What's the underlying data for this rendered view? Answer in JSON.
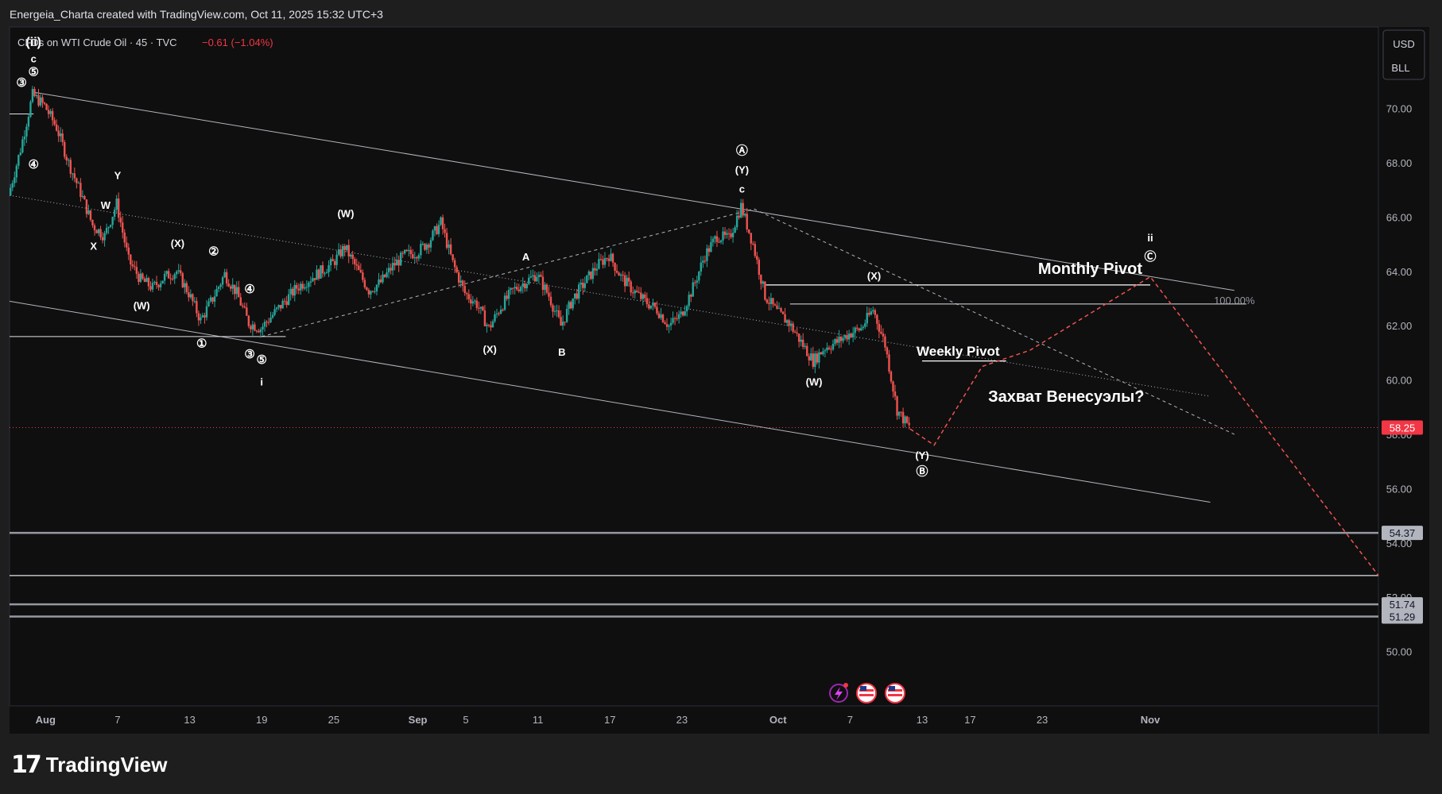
{
  "header": {
    "attribution": "Energeia_Charta created with TradingView.com, Oct 11, 2025 15:32 UTC+3"
  },
  "legend": {
    "symbol": "CFDs on WTI Crude Oil · 45 · TVC",
    "change": "−0.61 (−1.04%)"
  },
  "price_scale": {
    "currency": "USD",
    "unit": "BLL"
  },
  "footer": {
    "logo_word": "TradingView"
  },
  "colors": {
    "background": "#0f0f0f",
    "up": "#26a69a",
    "down": "#ef5350",
    "last_price": "#f23645",
    "grid_line": "#d1d4dc",
    "projection": "#ef5350"
  },
  "icons": [
    "lightning-event-icon",
    "us-flag-icon",
    "us-flag-icon"
  ],
  "chart_data": {
    "type": "candlestick",
    "title": "CFDs on WTI Crude Oil · 45 · TVC",
    "xlabel": "",
    "ylabel": "",
    "ylim": [
      48,
      73
    ],
    "xlim": [
      "2025-07-29",
      "2025-11-20"
    ],
    "y_ticks": [
      50,
      52,
      54,
      56,
      58,
      60,
      62,
      64,
      66,
      68,
      70,
      72
    ],
    "x_ticks": [
      {
        "date": "2025-08-01",
        "label": "Aug"
      },
      {
        "date": "2025-08-07",
        "label": "7"
      },
      {
        "date": "2025-08-13",
        "label": "13"
      },
      {
        "date": "2025-08-19",
        "label": "19"
      },
      {
        "date": "2025-08-25",
        "label": "25"
      },
      {
        "date": "2025-09-01",
        "label": "Sep"
      },
      {
        "date": "2025-09-05",
        "label": "5"
      },
      {
        "date": "2025-09-11",
        "label": "11"
      },
      {
        "date": "2025-09-17",
        "label": "17"
      },
      {
        "date": "2025-09-23",
        "label": "23"
      },
      {
        "date": "2025-10-01",
        "label": "Oct"
      },
      {
        "date": "2025-10-07",
        "label": "7"
      },
      {
        "date": "2025-10-13",
        "label": "13"
      },
      {
        "date": "2025-10-17",
        "label": "17"
      },
      {
        "date": "2025-10-23",
        "label": "23"
      },
      {
        "date": "2025-11-01",
        "label": "Nov"
      }
    ],
    "price_path": [
      [
        "2025-07-29",
        66.8
      ],
      [
        "2025-07-30",
        68.5
      ],
      [
        "2025-07-31",
        70.5
      ],
      [
        "2025-08-01",
        70.1
      ],
      [
        "2025-08-02",
        69.3
      ],
      [
        "2025-08-03",
        68.0
      ],
      [
        "2025-08-04",
        66.9
      ],
      [
        "2025-08-05",
        65.7
      ],
      [
        "2025-08-06",
        65.3
      ],
      [
        "2025-08-07",
        66.5
      ],
      [
        "2025-08-08",
        64.4
      ],
      [
        "2025-08-09",
        63.7
      ],
      [
        "2025-08-10",
        63.4
      ],
      [
        "2025-08-11",
        63.8
      ],
      [
        "2025-08-12",
        64.0
      ],
      [
        "2025-08-13",
        63.2
      ],
      [
        "2025-08-14",
        62.2
      ],
      [
        "2025-08-15",
        63.0
      ],
      [
        "2025-08-16",
        63.9
      ],
      [
        "2025-08-17",
        63.2
      ],
      [
        "2025-08-18",
        62.1
      ],
      [
        "2025-08-19",
        61.9
      ],
      [
        "2025-08-20",
        62.4
      ],
      [
        "2025-08-21",
        62.9
      ],
      [
        "2025-08-22",
        63.4
      ],
      [
        "2025-08-23",
        63.7
      ],
      [
        "2025-08-24",
        64.0
      ],
      [
        "2025-08-25",
        64.3
      ],
      [
        "2025-08-26",
        64.9
      ],
      [
        "2025-08-27",
        64.1
      ],
      [
        "2025-08-28",
        63.3
      ],
      [
        "2025-08-29",
        63.6
      ],
      [
        "2025-08-30",
        64.2
      ],
      [
        "2025-08-31",
        64.6
      ],
      [
        "2025-09-01",
        64.7
      ],
      [
        "2025-09-02",
        65.1
      ],
      [
        "2025-09-03",
        65.8
      ],
      [
        "2025-09-04",
        64.3
      ],
      [
        "2025-09-05",
        63.2
      ],
      [
        "2025-09-06",
        62.8
      ],
      [
        "2025-09-07",
        61.9
      ],
      [
        "2025-09-08",
        62.7
      ],
      [
        "2025-09-09",
        63.3
      ],
      [
        "2025-09-10",
        63.6
      ],
      [
        "2025-09-11",
        63.9
      ],
      [
        "2025-09-12",
        63.1
      ],
      [
        "2025-09-13",
        62.0
      ],
      [
        "2025-09-14",
        63.0
      ],
      [
        "2025-09-15",
        63.6
      ],
      [
        "2025-09-16",
        64.2
      ],
      [
        "2025-09-17",
        64.6
      ],
      [
        "2025-09-18",
        63.8
      ],
      [
        "2025-09-19",
        63.3
      ],
      [
        "2025-09-20",
        62.9
      ],
      [
        "2025-09-21",
        62.6
      ],
      [
        "2025-09-22",
        62.0
      ],
      [
        "2025-09-23",
        62.4
      ],
      [
        "2025-09-24",
        63.4
      ],
      [
        "2025-09-25",
        64.6
      ],
      [
        "2025-09-26",
        65.3
      ],
      [
        "2025-09-27",
        65.2
      ],
      [
        "2025-09-28",
        66.4
      ],
      [
        "2025-09-29",
        65.0
      ],
      [
        "2025-09-30",
        63.1
      ],
      [
        "2025-10-01",
        62.5
      ],
      [
        "2025-10-02",
        62.1
      ],
      [
        "2025-10-03",
        61.4
      ],
      [
        "2025-10-04",
        60.7
      ],
      [
        "2025-10-05",
        61.2
      ],
      [
        "2025-10-06",
        61.4
      ],
      [
        "2025-10-07",
        61.7
      ],
      [
        "2025-10-08",
        61.9
      ],
      [
        "2025-10-09",
        62.6
      ],
      [
        "2025-10-10",
        61.3
      ],
      [
        "2025-10-11",
        58.9
      ],
      [
        "2025-10-12",
        58.25
      ]
    ],
    "last_price": 58.25,
    "price_labels": [
      58.25,
      54.37,
      51.74,
      51.29
    ],
    "horizontal_levels": [
      54.37,
      52.8,
      51.74,
      51.29
    ],
    "annotations": [
      {
        "text": "(ii)",
        "date": "2025-07-31",
        "price": 72.3
      },
      {
        "text": "c",
        "date": "2025-07-31",
        "price": 71.7
      },
      {
        "text": "③",
        "date": "2025-07-30",
        "price": 70.8
      },
      {
        "text": "⑤",
        "date": "2025-07-31",
        "price": 71.2
      },
      {
        "text": "④",
        "date": "2025-07-31",
        "price": 67.8
      },
      {
        "text": "Y",
        "date": "2025-08-07",
        "price": 67.4
      },
      {
        "text": "W",
        "date": "2025-08-06",
        "price": 66.3
      },
      {
        "text": "X",
        "date": "2025-08-05",
        "price": 64.8
      },
      {
        "text": "(X)",
        "date": "2025-08-12",
        "price": 64.9
      },
      {
        "text": "(W)",
        "date": "2025-08-09",
        "price": 62.6
      },
      {
        "text": "②",
        "date": "2025-08-15",
        "price": 64.6
      },
      {
        "text": "④",
        "date": "2025-08-18",
        "price": 63.2
      },
      {
        "text": "①",
        "date": "2025-08-14",
        "price": 61.2
      },
      {
        "text": "③",
        "date": "2025-08-18",
        "price": 60.8
      },
      {
        "text": "⑤",
        "date": "2025-08-19",
        "price": 60.6
      },
      {
        "text": "i",
        "date": "2025-08-19",
        "price": 59.8
      },
      {
        "text": "(W)",
        "date": "2025-08-26",
        "price": 66.0
      },
      {
        "text": "A",
        "date": "2025-09-10",
        "price": 64.4
      },
      {
        "text": "(X)",
        "date": "2025-09-07",
        "price": 61.0
      },
      {
        "text": "B",
        "date": "2025-09-13",
        "price": 60.9
      },
      {
        "text": "Ⓐ",
        "date": "2025-09-28",
        "price": 68.3
      },
      {
        "text": "(Y)",
        "date": "2025-09-28",
        "price": 67.6
      },
      {
        "text": "c",
        "date": "2025-09-28",
        "price": 66.9
      },
      {
        "text": "(X)",
        "date": "2025-10-09",
        "price": 63.7
      },
      {
        "text": "(W)",
        "date": "2025-10-04",
        "price": 59.8
      },
      {
        "text": "(Y)",
        "date": "2025-10-13",
        "price": 57.1
      },
      {
        "text": "Ⓑ",
        "date": "2025-10-13",
        "price": 56.5
      },
      {
        "text": "ii",
        "date": "2025-11-01",
        "price": 65.1
      },
      {
        "text": "Ⓒ",
        "date": "2025-11-01",
        "price": 64.4
      },
      {
        "text": "Monthly Pivot",
        "date": "2025-10-27",
        "price": 63.9
      },
      {
        "text": "Weekly Pivot",
        "date": "2025-10-16",
        "price": 60.9
      },
      {
        "text": "100.00%",
        "date": "2025-11-08",
        "price": 62.8
      },
      {
        "text": "Захват Венесуэлы?",
        "date": "2025-10-25",
        "price": 59.2
      }
    ],
    "projection": [
      [
        "2025-10-12",
        58.2
      ],
      [
        "2025-10-14",
        57.6
      ],
      [
        "2025-10-18",
        60.5
      ],
      [
        "2025-10-22",
        61.1
      ],
      [
        "2025-11-01",
        63.8
      ],
      [
        "2025-11-20",
        52.8
      ]
    ],
    "pivots": {
      "monthly": 63.5,
      "weekly": 60.7
    },
    "grid": false,
    "legend_position": "top-left"
  }
}
